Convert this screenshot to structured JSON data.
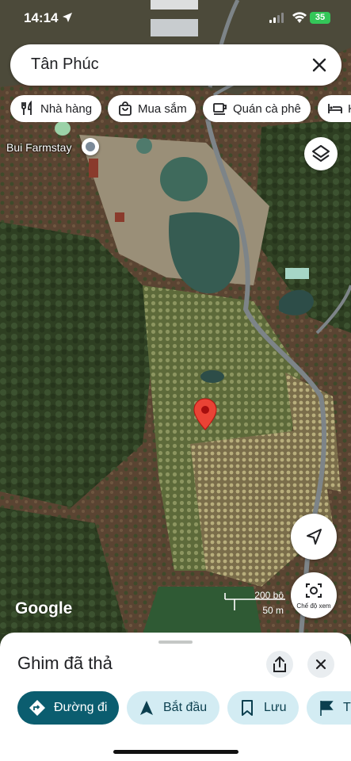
{
  "status_bar": {
    "time": "14:14",
    "battery": "35"
  },
  "search": {
    "query": "Tân Phúc"
  },
  "chips": [
    {
      "label": "Nhà hàng",
      "icon": "fork-knife-icon"
    },
    {
      "label": "Mua sắm",
      "icon": "shopping-bag-icon"
    },
    {
      "label": "Quán cà phê",
      "icon": "coffee-cup-icon"
    },
    {
      "label": "K",
      "icon": "bed-icon"
    }
  ],
  "map": {
    "place_label": "Bui Farmstay",
    "logo": "Google",
    "scale_top": "200 bộ",
    "scale_bottom": "50 m",
    "lens_label": "Chế độ xem"
  },
  "sheet": {
    "title": "Ghim đã thả",
    "actions": [
      {
        "label": "Đường đi",
        "icon": "directions-icon"
      },
      {
        "label": "Bắt đầu",
        "icon": "navigation-arrow-icon"
      },
      {
        "label": "Lưu",
        "icon": "bookmark-icon"
      },
      {
        "label": "T",
        "icon": "flag-icon"
      }
    ]
  },
  "colors": {
    "primary_action": "#0b5d6f",
    "secondary_action": "#d3ecf3",
    "pin_red": "#ea4335"
  }
}
